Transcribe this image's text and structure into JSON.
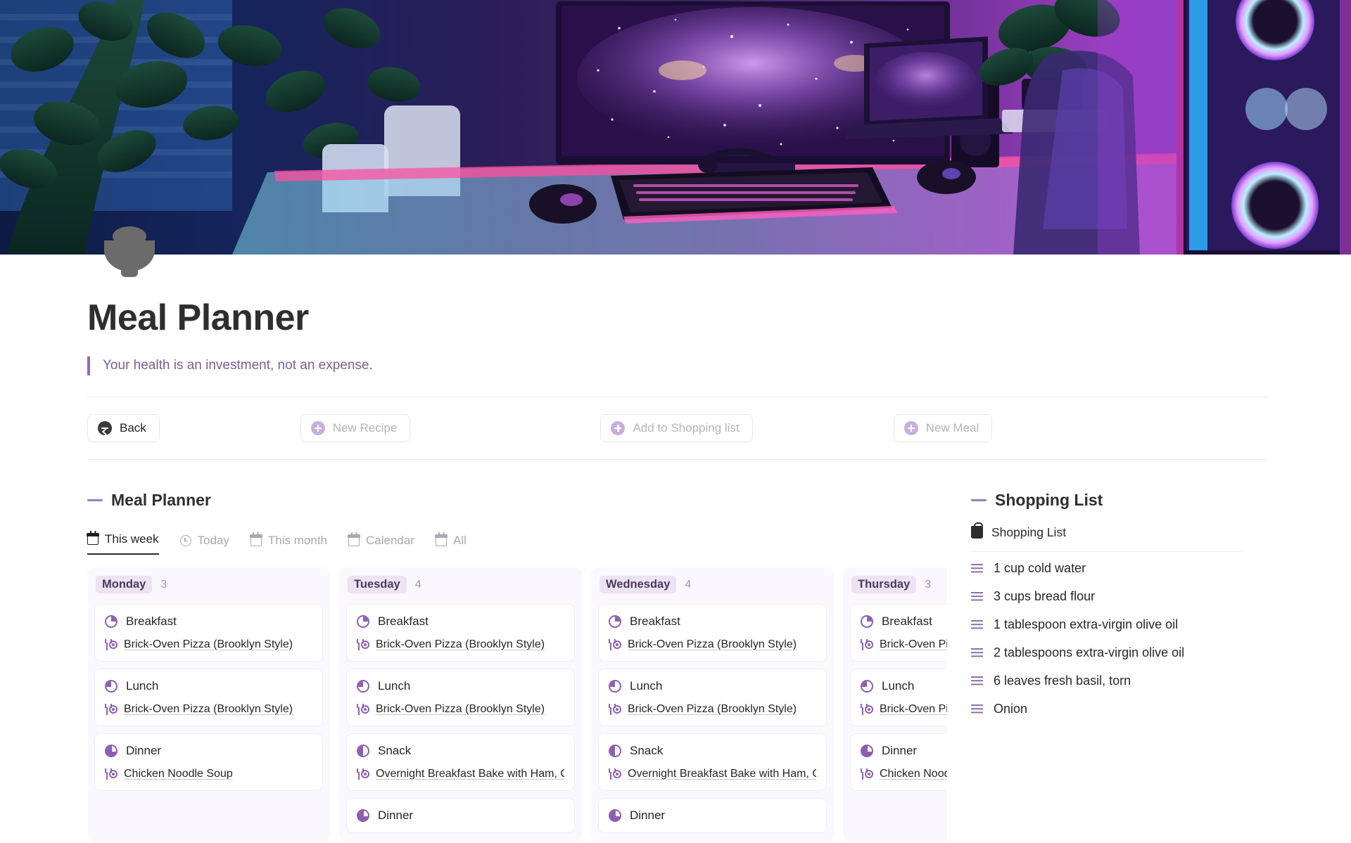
{
  "page": {
    "icon": "bowl-icon",
    "title": "Meal Planner",
    "quote": "Your health is an investment, not an expense."
  },
  "toolbar": {
    "buttons": [
      {
        "label": "Back",
        "icon": "back-circle-arrow-icon",
        "style": "primary"
      },
      {
        "label": "New Recipe",
        "icon": "plus-circle-icon",
        "style": "muted"
      },
      {
        "label": "Add to Shopping list",
        "icon": "plus-circle-icon",
        "style": "muted"
      },
      {
        "label": "New Meal",
        "icon": "plus-circle-icon",
        "style": "muted"
      }
    ]
  },
  "planner": {
    "heading": "Meal Planner",
    "tabs": [
      {
        "label": "This week",
        "icon": "calendar-icon",
        "active": true
      },
      {
        "label": "Today",
        "icon": "clock-icon",
        "active": false
      },
      {
        "label": "This month",
        "icon": "calendar-icon",
        "active": false
      },
      {
        "label": "Calendar",
        "icon": "calendar-icon",
        "active": false
      },
      {
        "label": "All",
        "icon": "calendar-icon",
        "active": false
      }
    ],
    "days": [
      {
        "name": "Monday",
        "count": "3",
        "meals": [
          {
            "type": "Breakfast",
            "icon": "pie-quarter-icon",
            "recipe": "Brick-Oven Pizza (Brooklyn Style)"
          },
          {
            "type": "Lunch",
            "icon": "pie-quarter-left-icon",
            "recipe": "Brick-Oven Pizza (Brooklyn Style)"
          },
          {
            "type": "Dinner",
            "icon": "pie-most-icon",
            "recipe": "Chicken Noodle Soup"
          }
        ]
      },
      {
        "name": "Tuesday",
        "count": "4",
        "meals": [
          {
            "type": "Breakfast",
            "icon": "pie-quarter-icon",
            "recipe": "Brick-Oven Pizza (Brooklyn Style)"
          },
          {
            "type": "Lunch",
            "icon": "pie-quarter-left-icon",
            "recipe": "Brick-Oven Pizza (Brooklyn Style)"
          },
          {
            "type": "Snack",
            "icon": "pie-half-icon",
            "recipe": "Overnight Breakfast Bake with Ham, Cheese"
          },
          {
            "type": "Dinner",
            "icon": "pie-most-icon",
            "recipe": ""
          }
        ]
      },
      {
        "name": "Wednesday",
        "count": "4",
        "meals": [
          {
            "type": "Breakfast",
            "icon": "pie-quarter-icon",
            "recipe": "Brick-Oven Pizza (Brooklyn Style)"
          },
          {
            "type": "Lunch",
            "icon": "pie-quarter-left-icon",
            "recipe": "Brick-Oven Pizza (Brooklyn Style)"
          },
          {
            "type": "Snack",
            "icon": "pie-half-icon",
            "recipe": "Overnight Breakfast Bake with Ham, Cheese"
          },
          {
            "type": "Dinner",
            "icon": "pie-most-icon",
            "recipe": ""
          }
        ]
      },
      {
        "name": "Thursday",
        "count": "3",
        "meals": [
          {
            "type": "Breakfast",
            "icon": "pie-quarter-icon",
            "recipe": "Brick-Oven Pizza (Brooklyn Style)"
          },
          {
            "type": "Lunch",
            "icon": "pie-quarter-left-icon",
            "recipe": "Brick-Oven Pizza (Brooklyn Style)"
          },
          {
            "type": "Dinner",
            "icon": "pie-most-icon",
            "recipe": "Chicken Noodle Soup"
          }
        ]
      }
    ]
  },
  "shopping": {
    "heading": "Shopping List",
    "subheading": "Shopping List",
    "subheading_icon": "shopping-bag-icon",
    "items": [
      "1 cup cold water",
      "3 cups bread flour",
      "1 tablespoon extra-virgin olive oil",
      "2 tablespoons extra-virgin olive oil",
      "6 leaves fresh basil, torn",
      "Onion"
    ]
  },
  "colors": {
    "accent": "#8e5fb0",
    "accent_soft": "#c9aedd",
    "chip_bg": "#ece3f3",
    "text": "#262626",
    "muted": "#b4b4bb"
  }
}
